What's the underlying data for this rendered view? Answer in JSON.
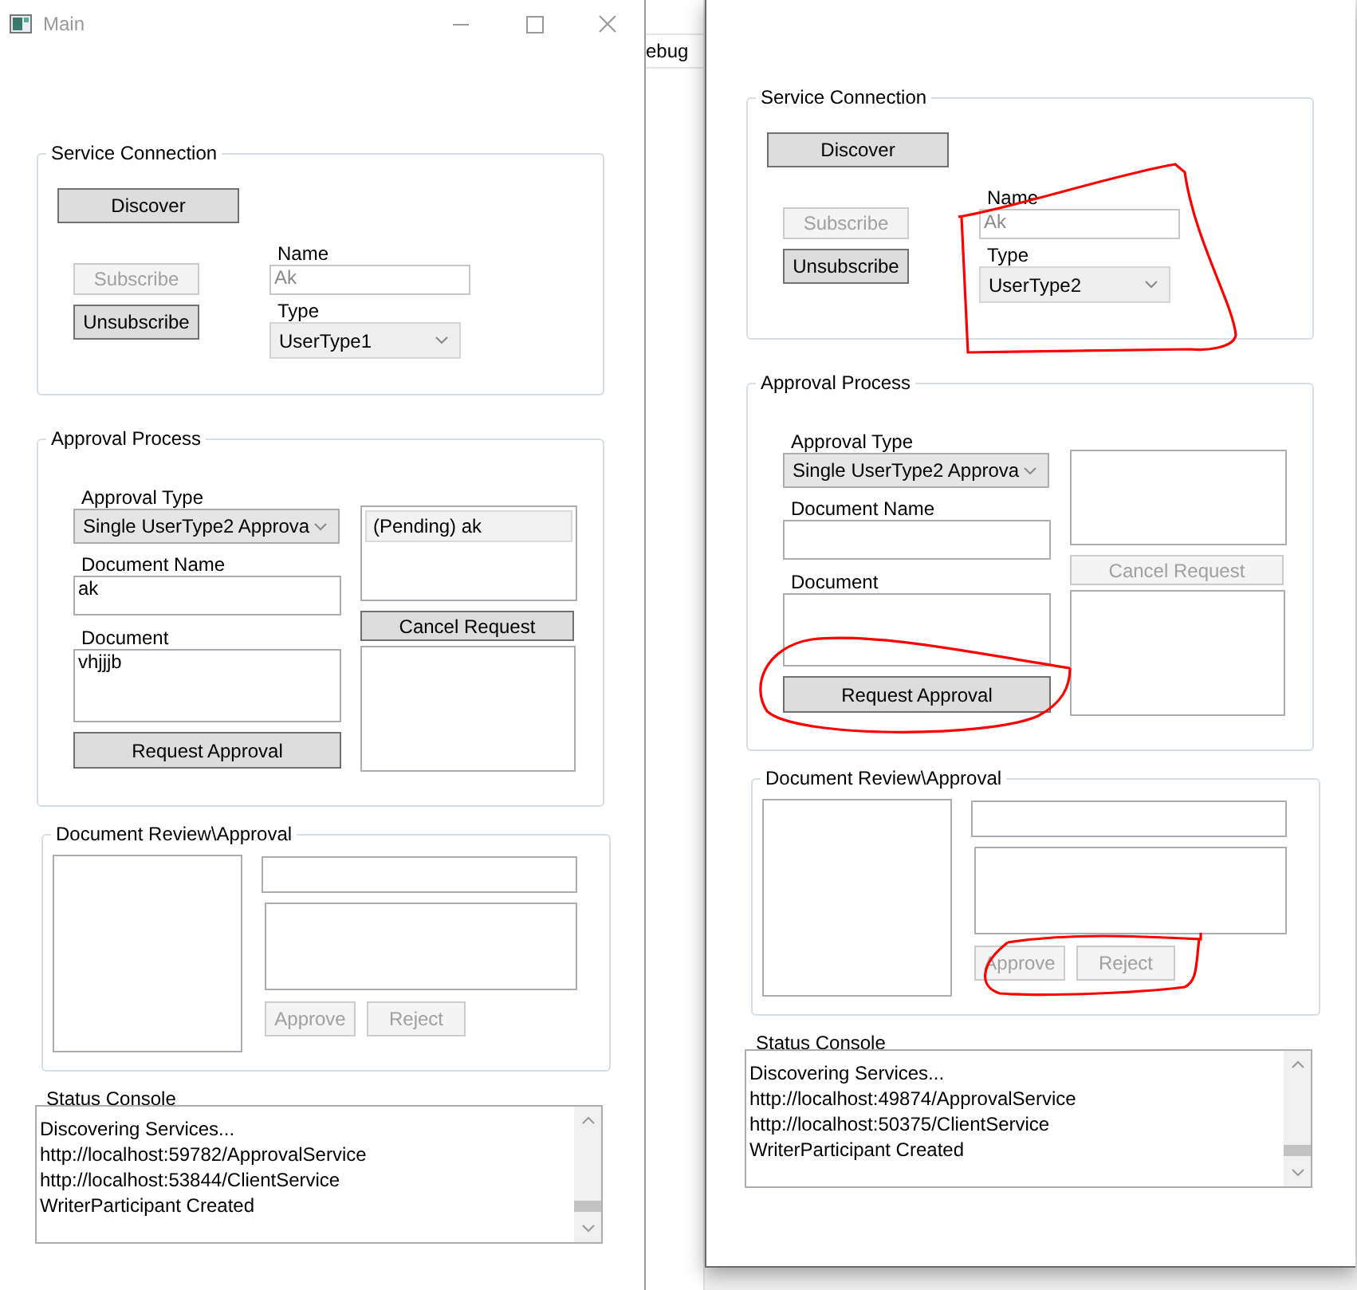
{
  "windows": [
    {
      "title": "Main",
      "service_connection": {
        "title": "Service Connection",
        "discover": {
          "label": "Discover",
          "disabled": false
        },
        "subscribe": {
          "label": "Subscribe",
          "disabled": true
        },
        "unsubscribe": {
          "label": "Unsubscribe",
          "disabled": false
        },
        "name_label": "Name",
        "name": {
          "value": "Ak",
          "disabled": true
        },
        "type_label": "Type",
        "type": {
          "value": "UserType1",
          "disabled": true
        },
        "annotated": false
      },
      "approval_process": {
        "title": "Approval Process",
        "approval_type_label": "Approval Type",
        "approval_type": {
          "value": "Single UserType2 Approva",
          "disabled": false
        },
        "document_name_label": "Document Name",
        "document_name": {
          "value": "ak"
        },
        "document_label": "Document",
        "document": {
          "value": "vhjjjb"
        },
        "request_approval": {
          "label": "Request Approval",
          "disabled": false
        },
        "requests": [
          {
            "text": "(Pending) ak",
            "selected": true
          }
        ],
        "cancel_request": {
          "label": "Cancel Request",
          "disabled": false
        },
        "annotated": false
      },
      "document_review": {
        "title": "Document Review\\Approval",
        "approve": {
          "label": "Approve",
          "disabled": true
        },
        "reject": {
          "label": "Reject",
          "disabled": true
        },
        "annotated": false
      },
      "status_console": {
        "title": "Status Console",
        "lines": [
          "Discovering Services...",
          "http://localhost:59782/ApprovalService",
          "http://localhost:53844/ClientService",
          "WriterParticipant Created"
        ]
      }
    },
    {
      "service_connection": {
        "title": "Service Connection",
        "discover": {
          "label": "Discover",
          "disabled": false
        },
        "subscribe": {
          "label": "Subscribe",
          "disabled": true
        },
        "unsubscribe": {
          "label": "Unsubscribe",
          "disabled": false
        },
        "name_label": "Name",
        "name": {
          "value": "Ak",
          "disabled": true
        },
        "type_label": "Type",
        "type": {
          "value": "UserType2",
          "disabled": true
        },
        "annotated": true
      },
      "approval_process": {
        "title": "Approval Process",
        "approval_type_label": "Approval Type",
        "approval_type": {
          "value": "Single UserType2 Approva",
          "disabled": false
        },
        "document_name_label": "Document Name",
        "document_label": "Document",
        "request_approval": {
          "label": "Request Approval",
          "disabled": false
        },
        "cancel_request": {
          "label": "Cancel Request",
          "disabled": true
        },
        "annotated": true
      },
      "document_review": {
        "title": "Document Review\\Approval",
        "approve": {
          "label": "Approve",
          "disabled": true
        },
        "reject": {
          "label": "Reject",
          "disabled": true
        },
        "annotated": true
      },
      "status_console": {
        "title": "Status Console",
        "lines": [
          "Discovering Services...",
          "http://localhost:49874/ApprovalService",
          "http://localhost:50375/ClientService",
          "WriterParticipant Created"
        ]
      }
    }
  ],
  "background_text": "ebug"
}
